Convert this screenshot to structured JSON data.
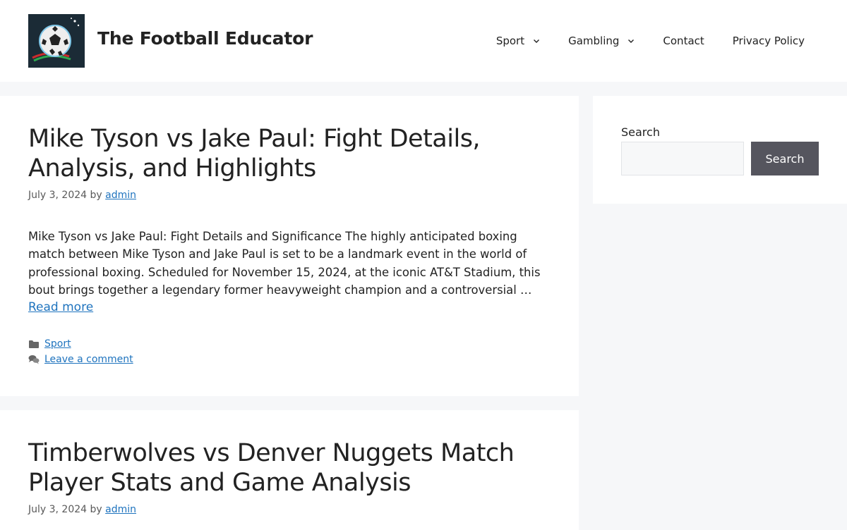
{
  "site": {
    "title": "The Football Educator",
    "logo_icon": "soccer-ball-logo-icon"
  },
  "nav": {
    "items": [
      {
        "label": "Sport",
        "has_dropdown": true
      },
      {
        "label": "Gambling",
        "has_dropdown": true
      },
      {
        "label": "Contact",
        "has_dropdown": false
      },
      {
        "label": "Privacy Policy",
        "has_dropdown": false
      }
    ]
  },
  "posts": [
    {
      "title": "Mike Tyson vs Jake Paul: Fight Details, Analysis, and Highlights",
      "date": "July 3, 2024",
      "by": "by",
      "author": "admin",
      "excerpt": "Mike Tyson vs Jake Paul: Fight Details and Significance The highly anticipated boxing match between Mike Tyson and Jake Paul is set to be a landmark event in the world of professional boxing. Scheduled for November 15, 2024, at the iconic AT&T Stadium, this bout brings together a legendary former heavyweight champion and a controversial …",
      "read_more": "Read more",
      "category": "Sport",
      "comment_link": "Leave a comment"
    },
    {
      "title": "Timberwolves vs Denver Nuggets Match Player Stats and Game Analysis",
      "date": "July 3, 2024",
      "by": "by",
      "author": "admin"
    }
  ],
  "sidebar": {
    "search_label": "Search",
    "search_value": "",
    "search_button": "Search"
  },
  "colors": {
    "link": "#1e73be",
    "page_bg": "#f6f7f9",
    "button_bg": "#55555e"
  }
}
